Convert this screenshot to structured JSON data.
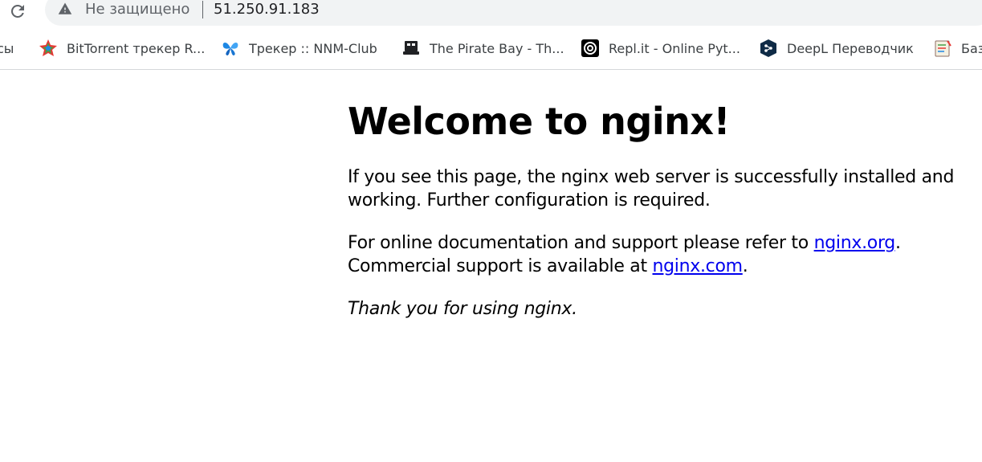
{
  "browser": {
    "security_label": "Не защищено",
    "url": "51.250.91.183"
  },
  "bookmarks": [
    {
      "label": "сы",
      "icon": "folder-icon"
    },
    {
      "label": "BitTorrent трекер R...",
      "icon": "rutracker-icon"
    },
    {
      "label": "Трекер :: NNM-Club",
      "icon": "butterfly-icon"
    },
    {
      "label": "The Pirate Bay - Th...",
      "icon": "pirate-ship-icon"
    },
    {
      "label": "Repl.it - Online Pyt...",
      "icon": "replit-icon"
    },
    {
      "label": "DeepL Переводчик",
      "icon": "deepl-icon"
    },
    {
      "label": "Баз",
      "icon": "notebook-icon"
    }
  ],
  "page": {
    "heading": "Welcome to nginx!",
    "para1": "If you see this page, the nginx web server is successfully installed and working. Further configuration is required.",
    "para2_prefix": "For online documentation and support please refer to ",
    "link_org": "nginx.org",
    "para2_mid": ".",
    "para2_line2": "Commercial support is available at ",
    "link_com": "nginx.com",
    "para2_end": ".",
    "para3": "Thank you for using nginx."
  }
}
